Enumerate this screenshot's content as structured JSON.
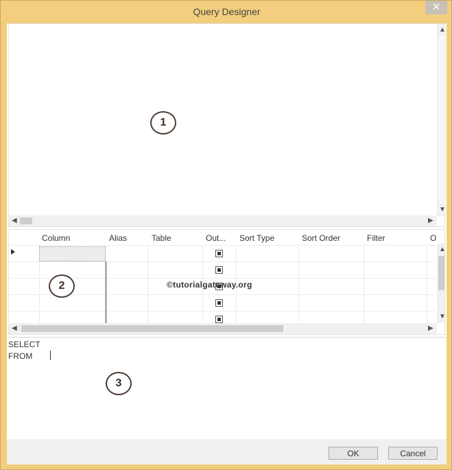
{
  "window": {
    "title": "Query Designer",
    "close_glyph": "✕"
  },
  "diagram_pane": {
    "badge": "1"
  },
  "grid_pane": {
    "badge": "2",
    "watermark": "©tutorialgateway.org",
    "columns": [
      "Column",
      "Alias",
      "Table",
      "Out...",
      "Sort Type",
      "Sort Order",
      "Filter",
      "O"
    ],
    "rows": [
      {
        "column": "",
        "alias": "",
        "table": "",
        "output": true,
        "sort_type": "",
        "sort_order": "",
        "filter": ""
      },
      {
        "column": "",
        "alias": "",
        "table": "",
        "output": true,
        "sort_type": "",
        "sort_order": "",
        "filter": ""
      },
      {
        "column": "",
        "alias": "",
        "table": "",
        "output": true,
        "sort_type": "",
        "sort_order": "",
        "filter": ""
      },
      {
        "column": "",
        "alias": "",
        "table": "",
        "output": true,
        "sort_type": "",
        "sort_order": "",
        "filter": ""
      },
      {
        "column": "",
        "alias": "",
        "table": "",
        "output": true,
        "sort_type": "",
        "sort_order": "",
        "filter": ""
      }
    ]
  },
  "sql_pane": {
    "badge": "3",
    "lines": [
      "SELECT",
      "FROM"
    ]
  },
  "footer": {
    "ok_label": "OK",
    "cancel_label": "Cancel"
  },
  "icons": {
    "close": "close-icon",
    "row_selector": "row-selector-arrow-icon"
  }
}
